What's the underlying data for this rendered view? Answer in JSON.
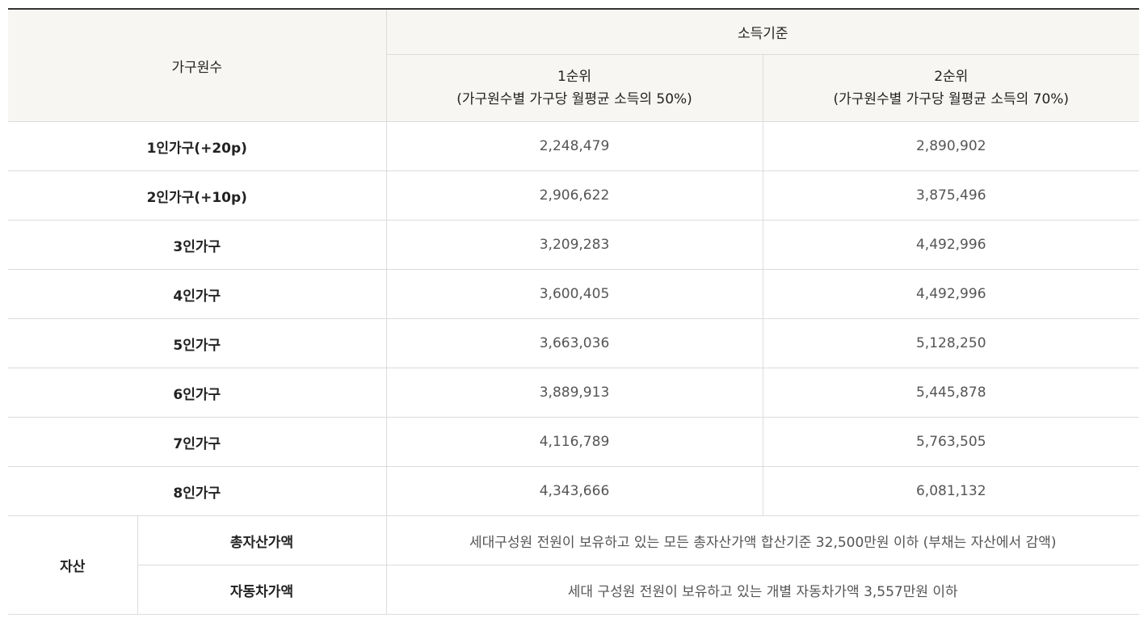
{
  "header": {
    "household_size": "가구원수",
    "income_standard": "소득기준",
    "rank1_title": "1순위",
    "rank1_desc": "(가구원수별 가구당 월평균 소득의 50%)",
    "rank2_title": "2순위",
    "rank2_desc": "(가구원수별 가구당 월평균 소득의 70%)"
  },
  "rows": [
    {
      "label": "1인가구(+20p)",
      "rank1": "2,248,479",
      "rank2": "2,890,902"
    },
    {
      "label": "2인가구(+10p)",
      "rank1": "2,906,622",
      "rank2": "3,875,496"
    },
    {
      "label": "3인가구",
      "rank1": "3,209,283",
      "rank2": "4,492,996"
    },
    {
      "label": "4인가구",
      "rank1": "3,600,405",
      "rank2": "4,492,996"
    },
    {
      "label": "5인가구",
      "rank1": "3,663,036",
      "rank2": "5,128,250"
    },
    {
      "label": "6인가구",
      "rank1": "3,889,913",
      "rank2": "5,445,878"
    },
    {
      "label": "7인가구",
      "rank1": "4,116,789",
      "rank2": "5,763,505"
    },
    {
      "label": "8인가구",
      "rank1": "4,343,666",
      "rank2": "6,081,132"
    }
  ],
  "assets": {
    "category": "자산",
    "total_label": "총자산가액",
    "total_desc": "세대구성원 전원이 보유하고 있는 모든 총자산가액 합산기준 32,500만원 이하 (부채는 자산에서 감액)",
    "car_label": "자동차가액",
    "car_desc": "세대 구성원 전원이 보유하고 있는 개별 자동차가액 3,557만원 이하"
  }
}
